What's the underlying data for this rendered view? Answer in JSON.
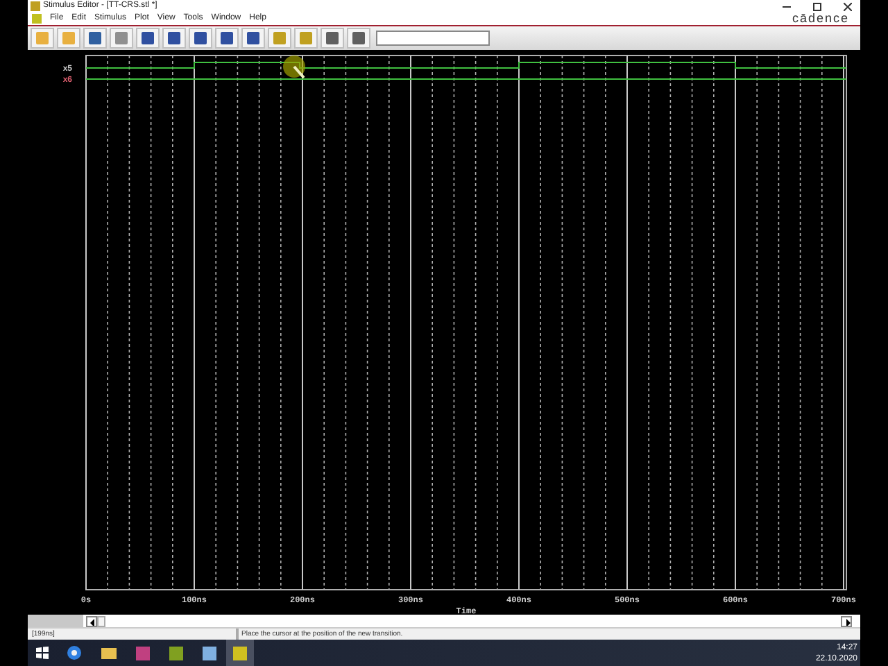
{
  "window": {
    "title": "Stimulus Editor - [TT-CRS.stl *]",
    "logo": "cādence"
  },
  "menu": [
    "File",
    "Edit",
    "Stimulus",
    "Plot",
    "View",
    "Tools",
    "Window",
    "Help"
  ],
  "signals": [
    {
      "name": "x5",
      "color": "#c8c8c8"
    },
    {
      "name": "x6",
      "color": "#e06070"
    }
  ],
  "axis": {
    "ticks": [
      "0s",
      "100ns",
      "200ns",
      "300ns",
      "400ns",
      "500ns",
      "600ns",
      "700ns"
    ],
    "label": "Time"
  },
  "status_bar": {
    "position": "[199ns]",
    "message": "Place the cursor at the position of the new transition."
  },
  "taskbar": {
    "time": "14:27",
    "date": "22.10.2020"
  }
}
